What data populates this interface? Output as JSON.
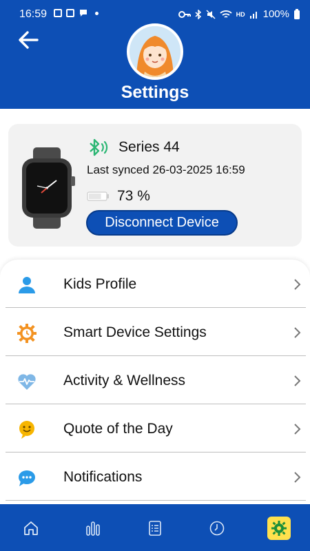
{
  "status_bar": {
    "time": "16:59",
    "network": "HD",
    "battery": "100%"
  },
  "header": {
    "title": "Settings"
  },
  "device": {
    "name": "Series 44",
    "last_synced": "Last synced 26-03-2025 16:59",
    "battery_pct": "73 %",
    "battery_level": 0.73,
    "disconnect_label": "Disconnect Device"
  },
  "menu": {
    "items": [
      {
        "label": "Kids Profile",
        "icon": "person-icon"
      },
      {
        "label": "Smart Device Settings",
        "icon": "gear-clock-icon"
      },
      {
        "label": "Activity & Wellness",
        "icon": "heart-pulse-icon"
      },
      {
        "label": "Quote of the Day",
        "icon": "smiley-icon"
      },
      {
        "label": "Notifications",
        "icon": "chat-bubble-icon"
      }
    ]
  },
  "bottom_nav": {
    "items": [
      {
        "icon": "home-icon"
      },
      {
        "icon": "bar-chart-icon"
      },
      {
        "icon": "checklist-icon"
      },
      {
        "icon": "clock-icon"
      },
      {
        "icon": "settings-gear-icon",
        "active": true
      }
    ]
  },
  "colors": {
    "primary": "#0d4fb5",
    "active_nav": "#ffe14d",
    "bluetooth": "#2bb673",
    "accent_orange": "#f39221",
    "icon_blue": "#2b9be8"
  }
}
